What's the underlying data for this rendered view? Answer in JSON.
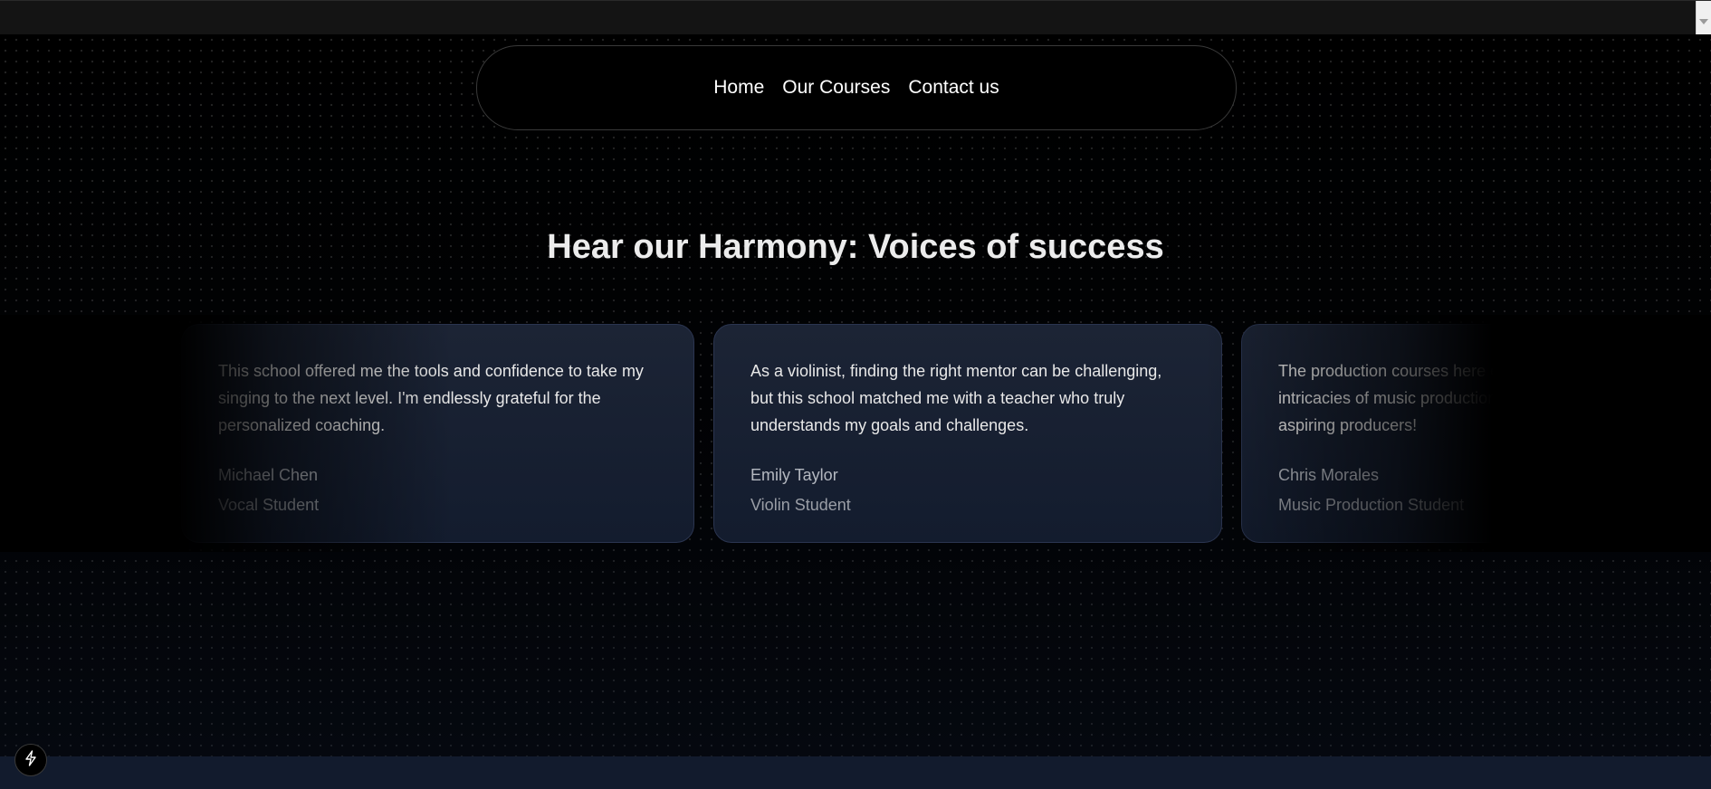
{
  "nav": {
    "links": [
      "Home",
      "Our Courses",
      "Contact us"
    ]
  },
  "heading": "Hear our Harmony: Voices of success",
  "testimonials": [
    {
      "quote": "This school offered me the tools and confidence to take my singing to the next level. I'm endlessly grateful for the personalized coaching.",
      "name": "Michael Chen",
      "role": "Vocal Student"
    },
    {
      "quote": "As a violinist, finding the right mentor can be challenging, but this school matched me with a teacher who truly understands my goals and challenges.",
      "name": "Emily Taylor",
      "role": "Violin Student"
    },
    {
      "quote": "The production courses here opened my eyes to the intricacies of music production. Highly recommend for aspiring producers!",
      "name": "Chris Morales",
      "role": "Music Production Student"
    }
  ],
  "badge": {
    "icon": "lightning-icon"
  },
  "colors": {
    "background": "#000000",
    "card": "#1c2435",
    "footer": "#121b2d",
    "text": "#ececec"
  }
}
